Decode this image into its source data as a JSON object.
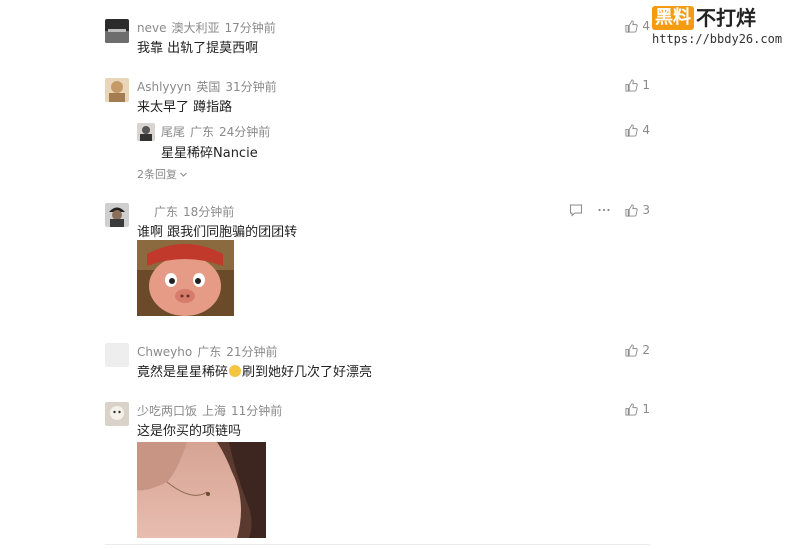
{
  "watermark": {
    "brand_box": "黑料",
    "brand_name": "不打烊",
    "url": "https://bbdy26.com"
  },
  "comments": [
    {
      "user": "neve",
      "location": "澳大利亚",
      "time": "17分钟前",
      "text": "我靠 出轨了提莫西啊",
      "likes": "4"
    },
    {
      "user": "Ashlyyyn",
      "location": "英国",
      "time": "31分钟前",
      "text": "来太早了 蹲指路",
      "likes": "1",
      "reply": {
        "user": "尾尾",
        "location": "广东",
        "time": "24分钟前",
        "text": "星星稀碎Nancie",
        "likes": "4"
      },
      "more_replies": "2条回复"
    },
    {
      "user": "",
      "location": "广东",
      "time": "18分钟前",
      "text": "谁啊 跟我们同胞骗的团团转",
      "likes": "3"
    },
    {
      "user": "Chweyho",
      "location": "广东",
      "time": "21分钟前",
      "text_before": "竟然是星星稀碎",
      "text_after": "刷到她好几次了好漂亮",
      "likes": "2"
    },
    {
      "user": "少吃两口饭",
      "location": "上海",
      "time": "11分钟前",
      "text": "这是你买的项链吗",
      "likes": "1"
    }
  ],
  "colors": {
    "meta": "#8a8a8a",
    "brand_orange": "#f39c12"
  }
}
